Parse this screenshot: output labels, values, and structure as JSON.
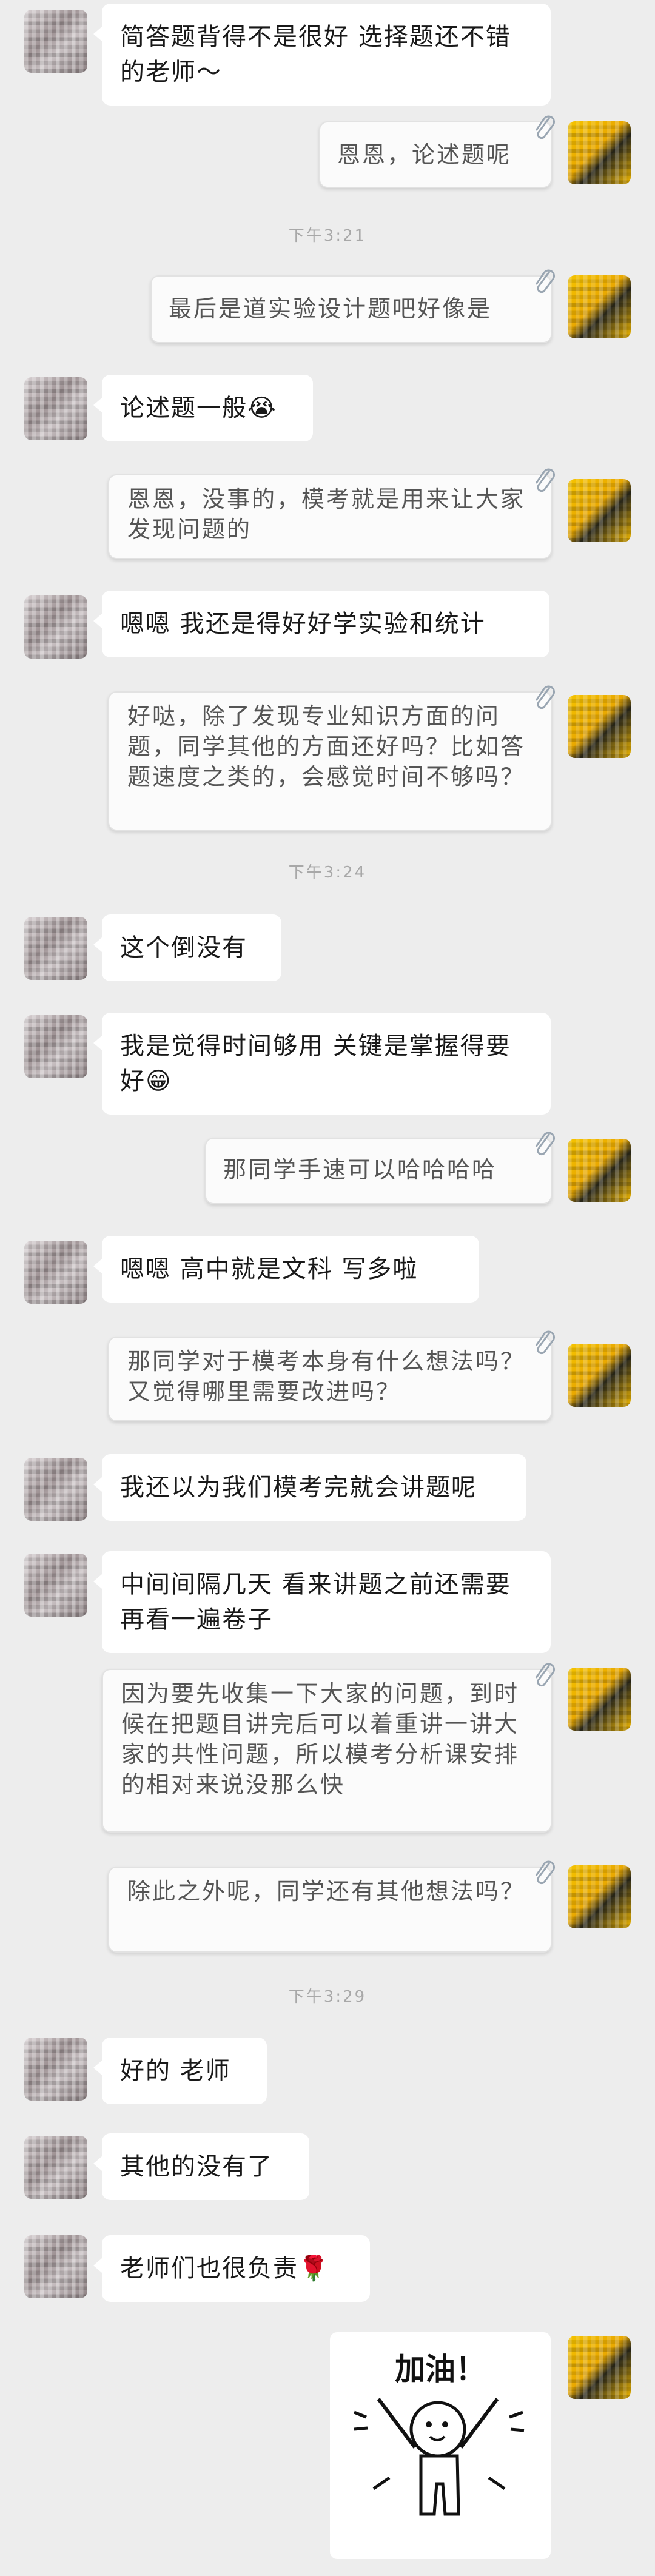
{
  "colors": {
    "background": "#ededed",
    "bubble": "#ffffff",
    "timestamp": "#a8a8a8"
  },
  "messages": [
    {
      "side": "left",
      "text": "简答题背得不是很好 选择题还不错的老师～"
    },
    {
      "side": "right",
      "text": "恩恩，论述题呢"
    },
    {
      "side": "time",
      "text": "下午3:21"
    },
    {
      "side": "right",
      "text": "最后是道实验设计题吧好像是"
    },
    {
      "side": "left",
      "text": "论述题一般😭"
    },
    {
      "side": "right",
      "text": "恩恩，没事的，模考就是用来让大家发现问题的"
    },
    {
      "side": "left",
      "text": "嗯嗯 我还是得好好学实验和统计"
    },
    {
      "side": "right",
      "text": "好哒，除了发现专业知识方面的问题，同学其他的方面还好吗？比如答题速度之类的，会感觉时间不够吗？"
    },
    {
      "side": "time",
      "text": "下午3:24"
    },
    {
      "side": "left",
      "text": "这个倒没有"
    },
    {
      "side": "left",
      "text": "我是觉得时间够用 关键是掌握得要好😁"
    },
    {
      "side": "right",
      "text": "那同学手速可以哈哈哈哈"
    },
    {
      "side": "left",
      "text": "嗯嗯 高中就是文科 写多啦"
    },
    {
      "side": "right",
      "text": "那同学对于模考本身有什么想法吗？又觉得哪里需要改进吗？"
    },
    {
      "side": "left",
      "text": "我还以为我们模考完就会讲题呢"
    },
    {
      "side": "left",
      "text": "中间间隔几天 看来讲题之前还需要再看一遍卷子"
    },
    {
      "side": "right",
      "text": "因为要先收集一下大家的问题，到时候在把题目讲完后可以着重讲一讲大家的共性问题，所以模考分析课安排的相对来说没那么快"
    },
    {
      "side": "right",
      "text": "除此之外呢，同学还有其他想法吗？"
    },
    {
      "side": "time",
      "text": "下午3:29"
    },
    {
      "side": "left",
      "text": "好的 老师"
    },
    {
      "side": "left",
      "text": "其他的没有了"
    },
    {
      "side": "left",
      "text": "老师们也很负责🌹"
    },
    {
      "side": "right-sticker",
      "text": "加油！"
    }
  ]
}
